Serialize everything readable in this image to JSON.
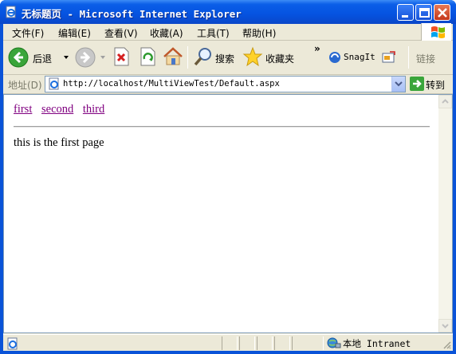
{
  "window": {
    "title": "无标题页 - Microsoft Internet Explorer"
  },
  "menubar": {
    "items": [
      "文件(F)",
      "编辑(E)",
      "查看(V)",
      "收藏(A)",
      "工具(T)",
      "帮助(H)"
    ]
  },
  "toolbar": {
    "back_label": "后退",
    "search_label": "搜索",
    "favorites_label": "收藏夹",
    "snagit_label": "SnagIt",
    "links_label": "链接",
    "chevron": "»"
  },
  "addressbar": {
    "label": "地址(D)",
    "url": "http://localhost/MultiViewTest/Default.aspx",
    "go_label": "转到"
  },
  "page": {
    "links": [
      "first",
      "second",
      "third"
    ],
    "text": "this is the first page"
  },
  "statusbar": {
    "zone_text": "本地 Intranet"
  },
  "colors": {
    "titlebar": "#0553e0",
    "visited_link": "#800080",
    "chrome": "#ece9d8"
  }
}
